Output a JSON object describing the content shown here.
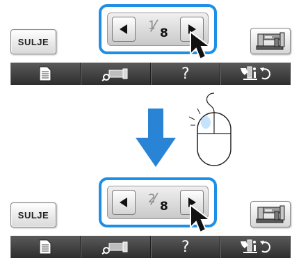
{
  "panels": [
    {
      "close_label": "SULJE",
      "pager": {
        "current": "1",
        "total": "8"
      }
    },
    {
      "close_label": "SULJE",
      "pager": {
        "current": "2",
        "total": "8"
      }
    }
  ],
  "toolbar": {
    "help_label": "?"
  },
  "icons": {
    "prev": "left-triangle-icon",
    "next": "right-triangle-icon",
    "document": "document-icon",
    "embroidery_search": "magnifier-frame-icon",
    "machine": "sewing-machine-icon",
    "settings": "settings-info-rotate-icon",
    "cursor": "mouse-pointer-icon",
    "down_arrow": "down-arrow-icon",
    "mouse": "mouse-click-icon"
  },
  "colors": {
    "highlight": "#1e8fe6",
    "toolbar": "#3c3c3c",
    "arrow": "#2a84d6"
  }
}
